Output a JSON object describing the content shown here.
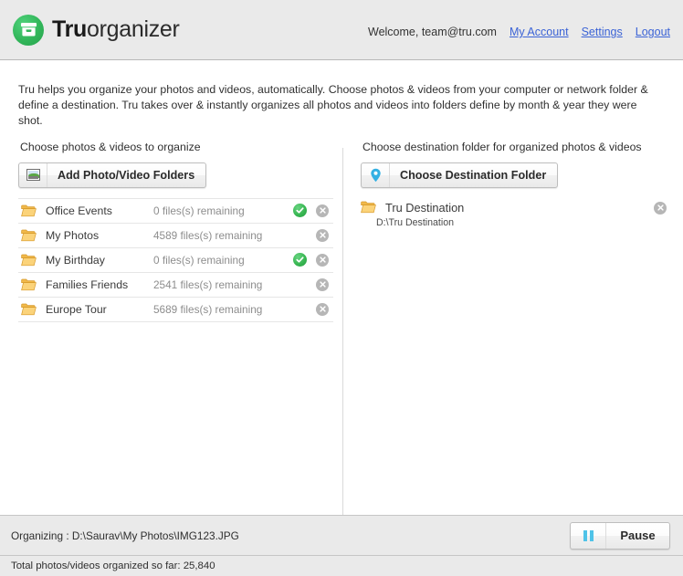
{
  "app": {
    "brand_bold": "Tru",
    "brand_light": "organizer",
    "logo_icon": "archive-box-icon",
    "brand_green": "#32b65a"
  },
  "header": {
    "welcome": "Welcome, team@tru.com",
    "links": [
      {
        "label": "My Account",
        "name": "my-account-link"
      },
      {
        "label": "Settings",
        "name": "settings-link"
      },
      {
        "label": "Logout",
        "name": "logout-link"
      }
    ],
    "link_color": "#3b63d6"
  },
  "intro": {
    "text": "Tru helps you organize your photos and videos, automatically. Choose photos & videos from your computer or network folder & define a destination. Tru takes over & instantly organizes all photos and videos into folders define by month & year they were shot."
  },
  "left_panel": {
    "title": "Choose photos & videos to organize",
    "add_button_label": "Add Photo/Video Folders",
    "add_button_icon": "photo-icon",
    "folders": [
      {
        "name": "Office Events",
        "count": "0 files(s) remaining",
        "done": true
      },
      {
        "name": "My Photos",
        "count": "4589 files(s) remaining",
        "done": false
      },
      {
        "name": "My Birthday",
        "count": "0 files(s) remaining",
        "done": true
      },
      {
        "name": "Families Friends",
        "count": "2541 files(s) remaining",
        "done": false
      },
      {
        "name": "Europe Tour",
        "count": "5689 files(s) remaining",
        "done": false
      }
    ]
  },
  "right_panel": {
    "title": "Choose destination folder for organized photos & videos",
    "choose_button_label": "Choose Destination Folder",
    "choose_button_icon": "location-pin-icon",
    "destination": {
      "name": "Tru Destination",
      "path": "D:\\Tru Destination"
    }
  },
  "footer": {
    "status_text": "Organizing : D:\\Saurav\\My Photos\\IMG123.JPG",
    "pause_label": "Pause",
    "pause_icon": "pause-icon",
    "total_text": "Total photos/videos organized so far: 25,840"
  }
}
